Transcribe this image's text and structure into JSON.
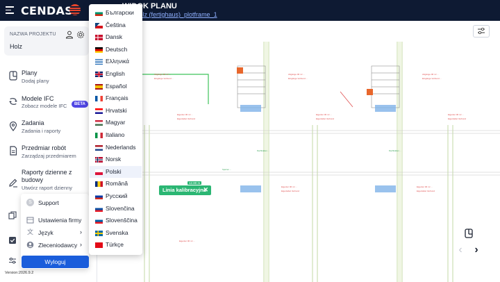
{
  "header": {
    "logo_text": "CENDAS",
    "title": "WIDOK PLANU",
    "plan_link": "plan holz (fertighaus)_plotframe_1"
  },
  "project": {
    "label": "NAZWA PROJEKTU",
    "name": "Holz"
  },
  "nav": [
    {
      "title": "Plany",
      "subtitle": "Dodaj plany",
      "icon": "plans-icon"
    },
    {
      "title": "Modele IFC",
      "subtitle": "Zobacz modele IFC",
      "icon": "ifc-models-icon",
      "badge": "BETA"
    },
    {
      "title": "Zadania",
      "subtitle": "Zadania i raporty",
      "icon": "location-pin-icon"
    },
    {
      "title": "Przedmiar robót",
      "subtitle": "Zarządzaj przedmiarem",
      "icon": "document-icon"
    },
    {
      "title": "Raporty dzienne z budowy",
      "subtitle": "Utwórz raport dzienny",
      "icon": "pen-icon"
    }
  ],
  "user_menu": {
    "support": "Support",
    "company_settings": "Ustawienia firmy",
    "language": "Język",
    "contractors": "Zleceniodawcy",
    "logout": "Wyloguj"
  },
  "languages": [
    {
      "label": "Български",
      "flag": "bg"
    },
    {
      "label": "Čeština",
      "flag": "cz"
    },
    {
      "label": "Dansk",
      "flag": "dk"
    },
    {
      "label": "Deutsch",
      "flag": "de"
    },
    {
      "label": "Ελληνικά",
      "flag": "gr"
    },
    {
      "label": "English",
      "flag": "gb"
    },
    {
      "label": "Español",
      "flag": "es"
    },
    {
      "label": "Français",
      "flag": "fr"
    },
    {
      "label": "Hrvatski",
      "flag": "hr"
    },
    {
      "label": "Magyar",
      "flag": "hu"
    },
    {
      "label": "Italiano",
      "flag": "it"
    },
    {
      "label": "Nederlands",
      "flag": "nl"
    },
    {
      "label": "Norsk",
      "flag": "no"
    },
    {
      "label": "Polski",
      "flag": "pl",
      "selected": true
    },
    {
      "label": "Română",
      "flag": "ro"
    },
    {
      "label": "Русский",
      "flag": "ru"
    },
    {
      "label": "Slovenčina",
      "flag": "sk"
    },
    {
      "label": "Slovenščina",
      "flag": "si"
    },
    {
      "label": "Svenska",
      "flag": "se"
    },
    {
      "label": "Türkçe",
      "flag": "tr"
    }
  ],
  "canvas": {
    "calibration_label": "Linia kalibracyjna",
    "calibration_value": "12.80 m"
  },
  "version": "Version:2026.9.2",
  "colors": {
    "header_bg": "#0e1a33",
    "accent": "#1a5ddb",
    "logo_accent": "#e8452c",
    "beta": "#5046e4",
    "calibration": "#2bb673"
  }
}
